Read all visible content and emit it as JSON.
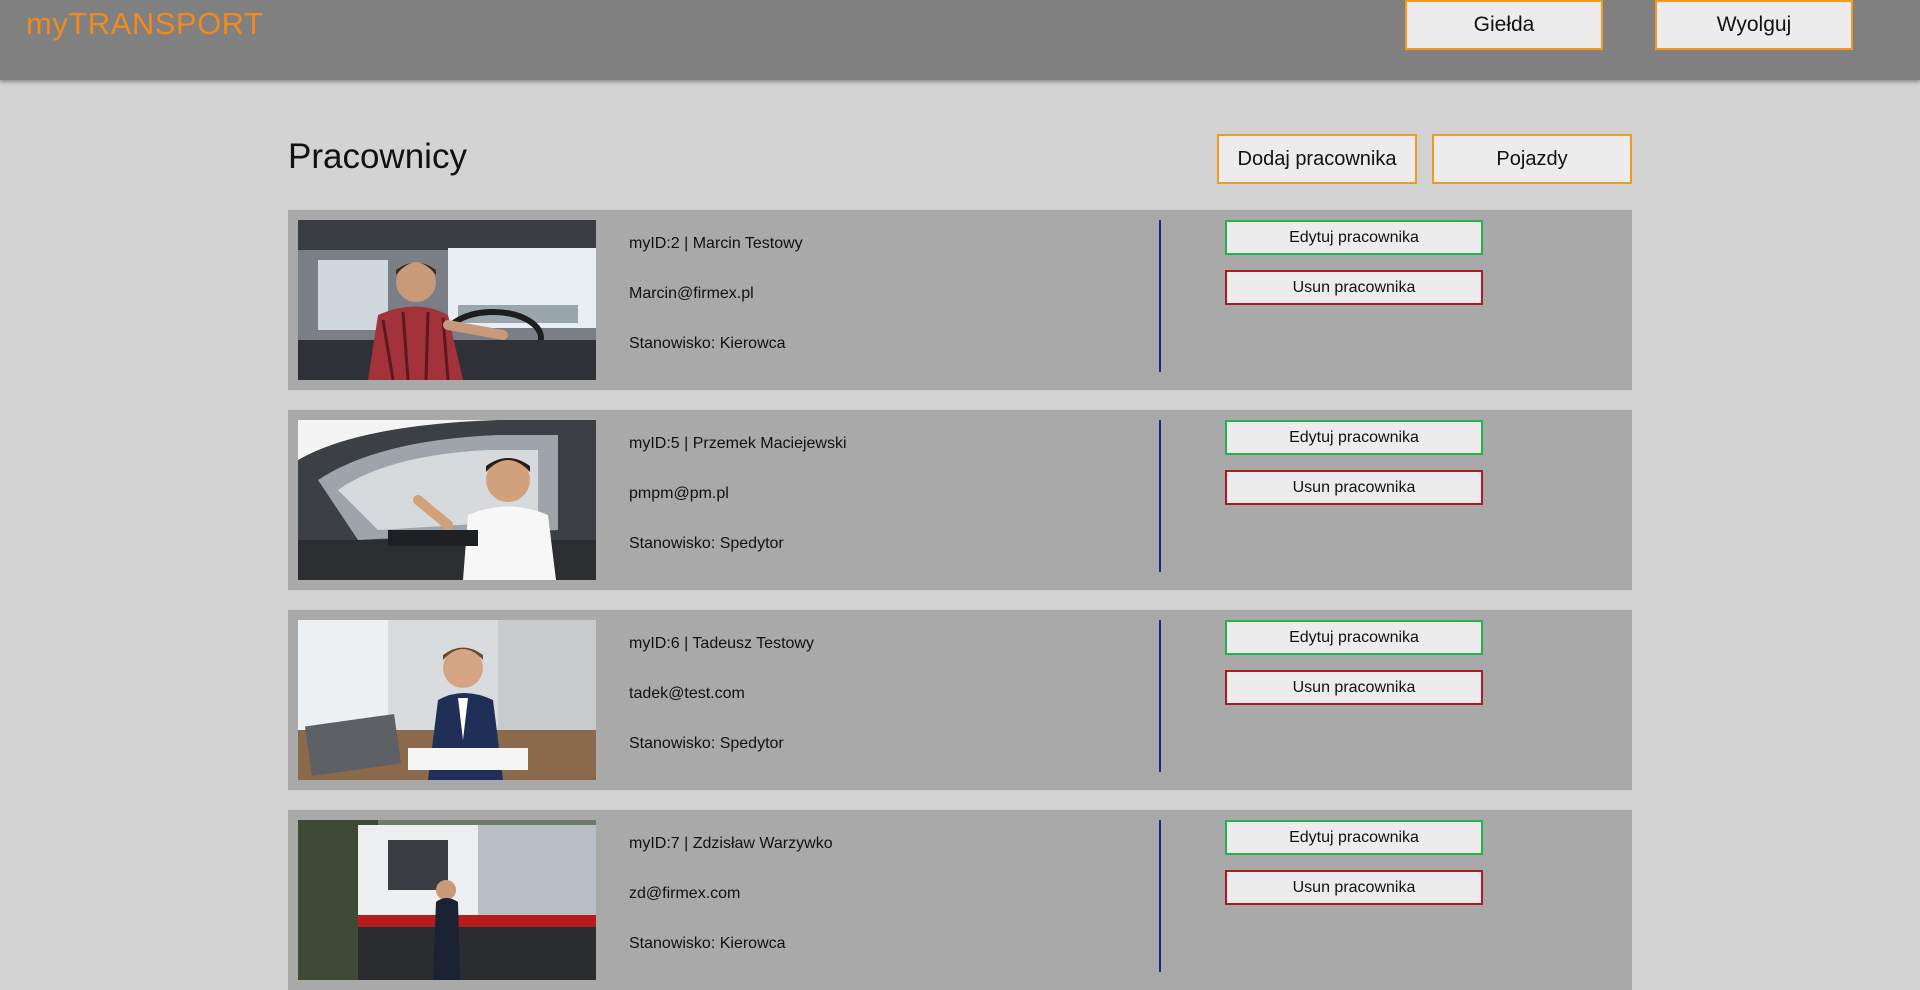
{
  "header": {
    "logo": "myTRANSPORT",
    "exchange_label": "Giełda",
    "logout_label": "Wyolguj"
  },
  "page": {
    "title": "Pracownicy",
    "add_employee_label": "Dodaj pracownika",
    "vehicles_label": "Pojazdy"
  },
  "employees": [
    {
      "id_line": "myID:2 | Marcin Testowy",
      "email": "Marcin@firmex.pl",
      "position": "Stanowisko: Kierowca",
      "edit_label": "Edytuj pracownika",
      "delete_label": "Usun pracownika",
      "photo": "truck-driver-photo"
    },
    {
      "id_line": "myID:5 | Przemek Maciejewski",
      "email": "pmpm@pm.pl",
      "position": "Stanowisko: Spedytor",
      "edit_label": "Edytuj pracownika",
      "delete_label": "Usun pracownika",
      "photo": "car-driver-photo"
    },
    {
      "id_line": "myID:6 | Tadeusz Testowy",
      "email": "tadek@test.com",
      "position": "Stanowisko: Spedytor",
      "edit_label": "Edytuj pracownika",
      "delete_label": "Usun pracownika",
      "photo": "businessman-photo"
    },
    {
      "id_line": "myID:7 | Zdzisław Warzywko",
      "email": "zd@firmex.com",
      "position": "Stanowisko: Kierowca",
      "edit_label": "Edytuj pracownika",
      "delete_label": "Usun pracownika",
      "photo": "truck-inspection-photo"
    }
  ],
  "colors": {
    "accent": "#f39a1e",
    "edit_border": "#22b24c",
    "delete_border": "#b0191f",
    "divider": "#1a237e",
    "header_bg": "#808080",
    "page_bg": "#d3d3d3",
    "card_bg": "#a9a9a9"
  }
}
